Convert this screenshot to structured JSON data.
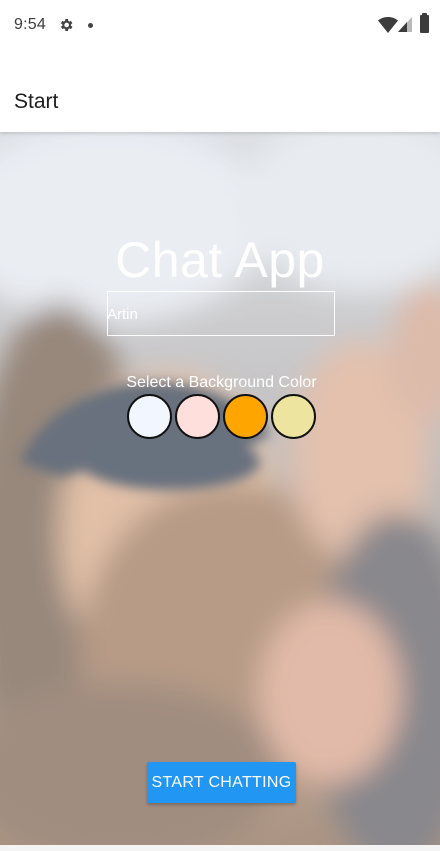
{
  "status_bar": {
    "time": "9:54",
    "icons": [
      "gear-icon",
      "notification-dot-icon",
      "wifi-icon",
      "signal-icon",
      "battery-icon"
    ]
  },
  "app_bar": {
    "title": "Start"
  },
  "main": {
    "title": "Chat App",
    "name_input": {
      "value": "Artin",
      "placeholder": ""
    },
    "color_label": "Select a Background Color",
    "color_options": [
      {
        "name": "color-option-1",
        "color": "#f2f6ff"
      },
      {
        "name": "color-option-2",
        "color": "#ffdfdc"
      },
      {
        "name": "color-option-3",
        "color": "#ffa500"
      },
      {
        "name": "color-option-4",
        "color": "#ece49f"
      }
    ],
    "start_button": "START CHATTING"
  },
  "colors": {
    "accent": "#2196f3"
  }
}
